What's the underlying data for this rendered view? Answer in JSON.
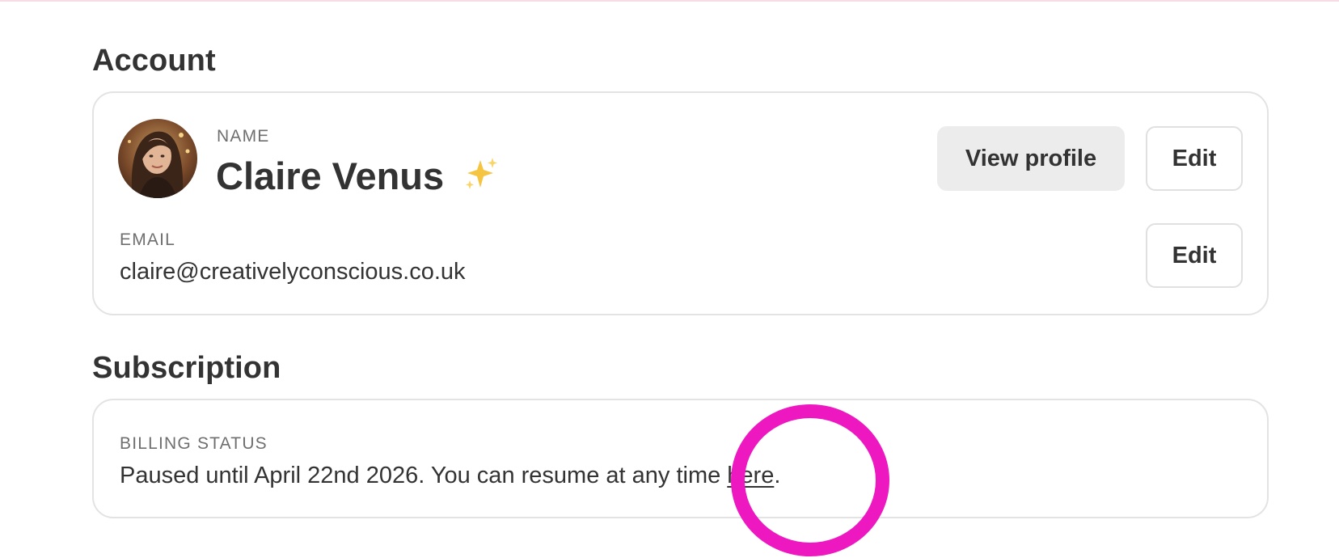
{
  "account": {
    "section_title": "Account",
    "name_label": "NAME",
    "name_value": "Claire Venus",
    "name_emoji_icon": "sparkles-icon",
    "view_profile_label": "View profile",
    "edit_name_label": "Edit",
    "email_label": "EMAIL",
    "email_value": "claire@creativelyconscious.co.uk",
    "edit_email_label": "Edit"
  },
  "subscription": {
    "section_title": "Subscription",
    "billing_label": "BILLING STATUS",
    "billing_text": "Paused until April 22nd 2026. You can resume at any time ",
    "billing_link": "here",
    "billing_end": "."
  },
  "colors": {
    "accent_top_rule": "#f7dce6",
    "annotation_ring": "#ee18c1",
    "sparkle": "#f5c542",
    "button_secondary_bg": "#ececec",
    "card_border": "#e3e3e3"
  }
}
